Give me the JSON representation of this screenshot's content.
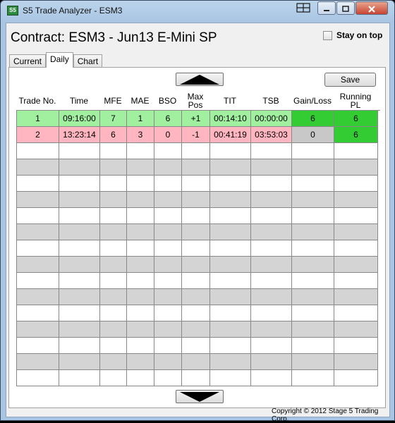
{
  "window": {
    "title": "S5 Trade Analyzer - ESM3",
    "icon_text": "S5"
  },
  "header": {
    "contract_title": "Contract: ESM3 - Jun13 E-Mini SP",
    "stay_on_top_label": "Stay on top",
    "stay_on_top_checked": false
  },
  "tabs": [
    {
      "label": "Current",
      "active": false
    },
    {
      "label": "Daily",
      "active": true
    },
    {
      "label": "Chart",
      "active": false
    }
  ],
  "toolbar": {
    "save_label": "Save"
  },
  "table": {
    "headers": [
      "Trade No.",
      "Time",
      "MFE",
      "MAE",
      "BSO",
      "Max Pos",
      "TIT",
      "TSB",
      "Gain/Loss",
      "Running PL"
    ],
    "rows": [
      [
        "1",
        "09:16:00",
        "7",
        "1",
        "6",
        "+1",
        "00:14:10",
        "00:00:00",
        "6",
        "6"
      ],
      [
        "2",
        "13:23:14",
        "6",
        "3",
        "0",
        "-1",
        "00:41:19",
        "03:53:03",
        "0",
        "6"
      ]
    ],
    "row_colors": [
      "#a0f0a0",
      "#ffb6c1"
    ],
    "gain_colors": [
      "#33cc33",
      "#c8c8c8"
    ],
    "running_pl_colors": [
      "#33cc33",
      "#33cc33"
    ],
    "empty_row_colors": [
      "#ffffff",
      "#d4d4d4"
    ]
  },
  "footer": {
    "copyright": "Copyright © 2012 Stage 5 Trading Corp."
  }
}
